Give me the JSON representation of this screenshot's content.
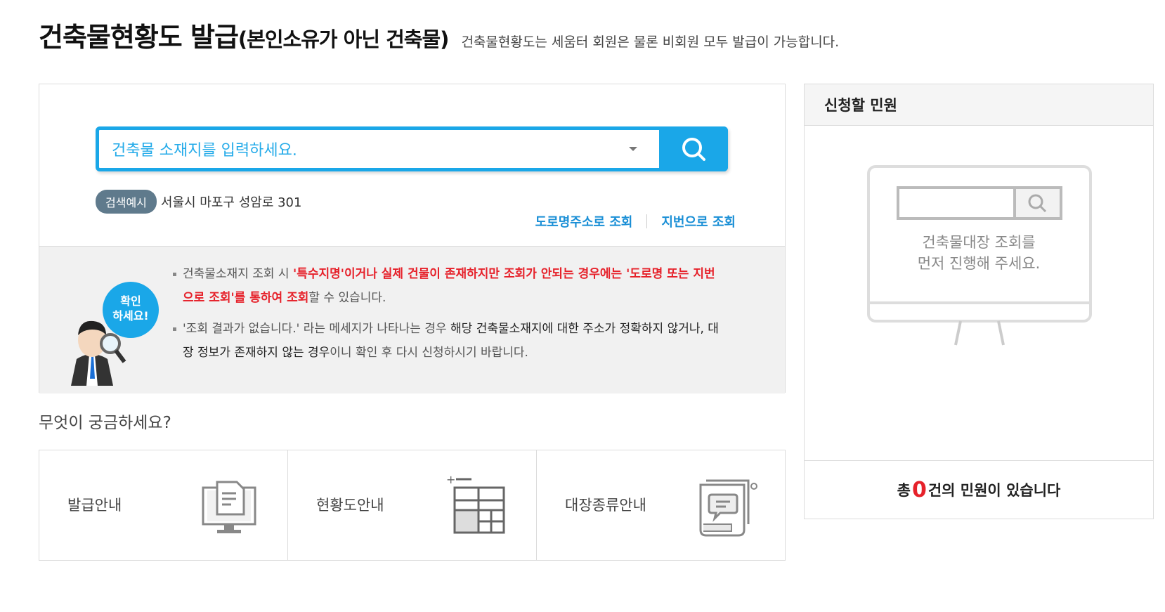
{
  "header": {
    "title": "건축물현황도 발급",
    "title_sub": "(본인소유가 아닌 건축물)",
    "description": "건축물현황도는 세움터 회원은 물론 비회원 모두 발급이 가능합니다."
  },
  "search": {
    "placeholder": "건축물 소재지를 입력하세요.",
    "example_badge": "검색예시",
    "example_text": "서울시 마포구 성암로 301",
    "link_road": "도로명주소로 조회",
    "link_lot": "지번으로 조회"
  },
  "notice": {
    "figure_text_1": "확인",
    "figure_text_2": "하세요!",
    "item1_a": "건축물소재지 조회 시 ",
    "item1_b": "'특수지명'이거나 실제 건물이 존재하지만 조회가 안되는 경우에는 '도로명 또는 지번으로 조회'를 통하여 조회",
    "item1_c": "할 수 있습니다.",
    "item2_a": "'조회 결과가 없습니다.' 라는 메세지가 나타나는 경우 ",
    "item2_b": "해당 건축물소재지에 대한 주소가 정확하지 않거나, 대장 정보가 존재하지 않는 경우",
    "item2_c": "이니 확인 후 다시 신청하시기 바랍니다."
  },
  "faq": {
    "title": "무엇이 궁금하세요?",
    "cards": [
      {
        "label": "발급안내",
        "icon": "monitor-document-icon"
      },
      {
        "label": "현황도안내",
        "icon": "floor-plan-icon"
      },
      {
        "label": "대장종류안내",
        "icon": "scroll-document-icon"
      }
    ]
  },
  "request": {
    "title": "신청할 민원",
    "empty_line1": "건축물대장 조회를",
    "empty_line2": "먼저 진행해 주세요.",
    "footer_prefix": "총 ",
    "count": "0",
    "footer_suffix": "건의 민원이 있습니다"
  },
  "colors": {
    "accent": "#1aa7e8",
    "highlight": "#e6212a",
    "badge": "#5f7a8c"
  }
}
